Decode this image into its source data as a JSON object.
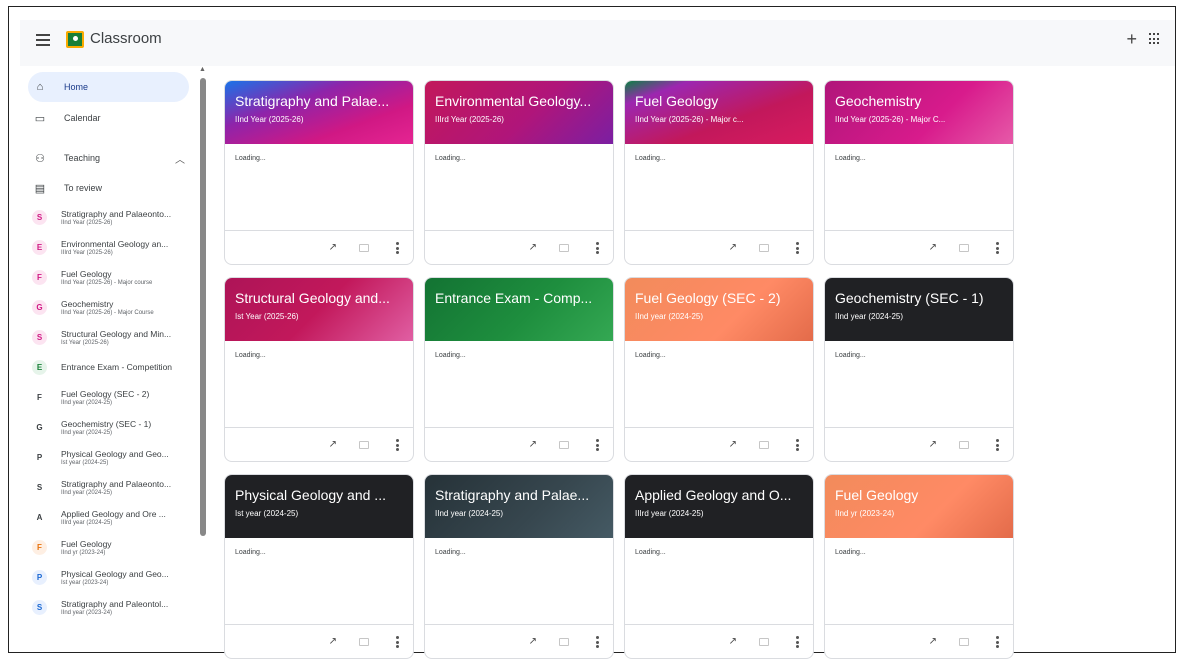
{
  "header": {
    "title": "Classroom"
  },
  "nav": {
    "home": "Home",
    "calendar": "Calendar",
    "teaching": "Teaching",
    "to_review": "To review"
  },
  "sidebar_courses": [
    {
      "letter": "S",
      "title": "Stratigraphy and Palaeonto...",
      "sub": "IInd Year (2025-26)",
      "color": "#d01884",
      "bg": "#fce4f1"
    },
    {
      "letter": "E",
      "title": "Environmental Geology an...",
      "sub": "IIIrd Year (2025-26)",
      "color": "#d01884",
      "bg": "#fce4f1"
    },
    {
      "letter": "F",
      "title": "Fuel Geology",
      "sub": "IInd Year (2025-26) - Major course",
      "color": "#d01884",
      "bg": "#fce4f1"
    },
    {
      "letter": "G",
      "title": "Geochemistry",
      "sub": "IInd Year (2025-26) - Major Course",
      "color": "#d01884",
      "bg": "#fce4f1"
    },
    {
      "letter": "S",
      "title": "Structural Geology and Min...",
      "sub": "Ist Year (2025-26)",
      "color": "#d01884",
      "bg": "#fce4f1"
    },
    {
      "letter": "E",
      "title": "Entrance Exam - Competition",
      "sub": "",
      "color": "#188038",
      "bg": "#e6f4ea"
    },
    {
      "letter": "F",
      "title": "Fuel Geology (SEC - 2)",
      "sub": "IInd year (2024-25)",
      "color": "#3c4043",
      "bg": "#ffffff"
    },
    {
      "letter": "G",
      "title": "Geochemistry (SEC - 1)",
      "sub": "IInd year (2024-25)",
      "color": "#3c4043",
      "bg": "#ffffff"
    },
    {
      "letter": "P",
      "title": "Physical Geology and Geo...",
      "sub": "Ist year (2024-25)",
      "color": "#3c4043",
      "bg": "#ffffff"
    },
    {
      "letter": "S",
      "title": "Stratigraphy and Palaeonto...",
      "sub": "IInd year (2024-25)",
      "color": "#3c4043",
      "bg": "#ffffff"
    },
    {
      "letter": "A",
      "title": "Applied Geology and Ore ...",
      "sub": "IIIrd year (2024-25)",
      "color": "#3c4043",
      "bg": "#ffffff"
    },
    {
      "letter": "F",
      "title": "Fuel Geology",
      "sub": "IInd yr (2023-24)",
      "color": "#e8710a",
      "bg": "#feefe3"
    },
    {
      "letter": "P",
      "title": "Physical Geology and Geo...",
      "sub": "Ist year (2023-24)",
      "color": "#1967d2",
      "bg": "#e8f0fe"
    },
    {
      "letter": "S",
      "title": "Stratigraphy and Paleontol...",
      "sub": "IInd year (2023-24)",
      "color": "#1967d2",
      "bg": "#e8f0fe"
    }
  ],
  "cards": [
    {
      "title": "Stratigraphy and Palae...",
      "sub": "IInd Year (2025-26)",
      "body": "Loading...",
      "bg": "linear-gradient(160deg,#1a73e8 0%,#8e24aa 35%,#d01884 70%,#e52592 100%)"
    },
    {
      "title": "Environmental Geology...",
      "sub": "IIIrd Year (2025-26)",
      "body": "Loading...",
      "bg": "linear-gradient(135deg,#c2185b 0%,#b0157a 55%,#7b1fa2 100%)"
    },
    {
      "title": "Fuel Geology",
      "sub": "IInd Year (2025-26) - Major c...",
      "body": "Loading...",
      "bg": "linear-gradient(160deg,#0b8043 0%,#9c27b0 18%,#c2185b 60%,#d81b60 100%)"
    },
    {
      "title": "Geochemistry",
      "sub": "IInd Year (2025-26) - Major C...",
      "body": "Loading...",
      "bg": "linear-gradient(135deg,#b0157a 0%,#d81b8c 60%,#e65aa8 100%)"
    },
    {
      "title": "Structural Geology and...",
      "sub": "Ist Year (2025-26)",
      "body": "Loading...",
      "bg": "linear-gradient(135deg,#ad1457 0%,#c2185b 50%,#e05fa3 100%)"
    },
    {
      "title": "Entrance Exam - Comp...",
      "sub": "",
      "body": "Loading...",
      "bg": "linear-gradient(135deg,#137333 0%,#1e8e3e 55%,#34a853 100%)"
    },
    {
      "title": "Fuel Geology (SEC - 2)",
      "sub": "IInd year (2024-25)",
      "body": "Loading...",
      "bg": "linear-gradient(135deg,#f28b5b 0%,#ff8a65 60%,#e36b4a 100%)"
    },
    {
      "title": "Geochemistry (SEC - 1)",
      "sub": "IInd year (2024-25)",
      "body": "Loading...",
      "bg": "#202124"
    },
    {
      "title": "Physical Geology and ...",
      "sub": "Ist year (2024-25)",
      "body": "Loading...",
      "bg": "#202124"
    },
    {
      "title": "Stratigraphy and Palae...",
      "sub": "IInd year (2024-25)",
      "body": "Loading...",
      "bg": "linear-gradient(135deg,#263238 0%,#37474f 60%,#455a64 100%)"
    },
    {
      "title": "Applied Geology and O...",
      "sub": "IIIrd year (2024-25)",
      "body": "Loading...",
      "bg": "#202124"
    },
    {
      "title": "Fuel Geology",
      "sub": "IInd yr (2023-24)",
      "body": "Loading...",
      "bg": "linear-gradient(135deg,#f28b5b 0%,#ff8a65 60%,#e36b4a 100%)"
    }
  ]
}
